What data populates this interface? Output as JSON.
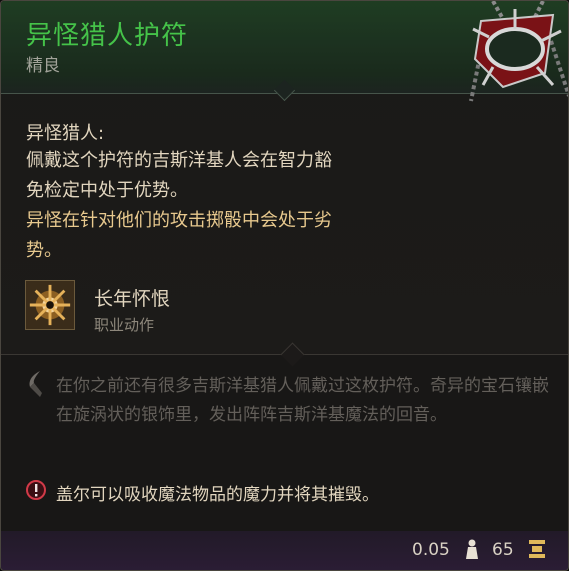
{
  "item": {
    "name": "异怪猎人护符",
    "rarity": "精良",
    "rarity_color": "#45c349"
  },
  "passive": {
    "title": "异怪猎人:",
    "desc_lines": [
      "佩戴这个护符的吉斯洋基人会在智力豁",
      "免检定中处于优势。",
      "异怪在针对他们的攻击掷骰中会处于劣",
      "势。"
    ]
  },
  "action": {
    "icon": "grudge-action-icon",
    "name": "长年怀恨",
    "type": "职业动作"
  },
  "lore": {
    "icon": "quill-icon",
    "text": "在你之前还有很多吉斯洋基猎人佩戴过这枚护符。奇异的宝石镶嵌在旋涡状的银饰里，发出阵阵吉斯洋基魔法的回音。"
  },
  "note": {
    "icon": "warning-icon",
    "text": "盖尔可以吸收魔法物品的魔力并将其摧毁。"
  },
  "footer": {
    "weight": "0.05",
    "weight_icon": "weight-icon",
    "value": "65",
    "value_icon": "gold-icon"
  }
}
